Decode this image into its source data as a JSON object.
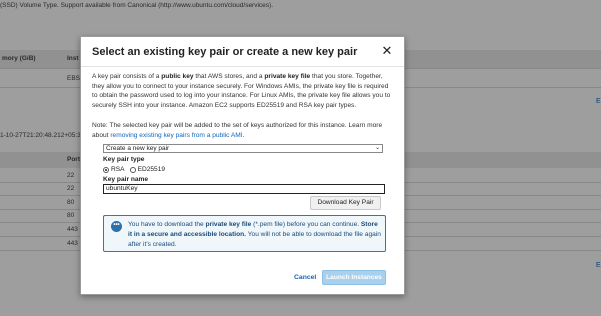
{
  "background": {
    "top_text": "(SSD) Volume Type. Support available from Canonical (http://www.ubuntu.com/cloud/services).",
    "col_memory": "mory (GiB)",
    "col_inst": "Inst",
    "ebs": "EBS",
    "timestamp": "1-10-27T21:20:48.212+05:3",
    "port_header": "Port",
    "ports": [
      "22",
      "22",
      "80",
      "80",
      "443",
      "443"
    ],
    "right_edge_1": "E",
    "right_edge_2": "E"
  },
  "modal": {
    "title": "Select an existing key pair or create a new key pair",
    "close_icon": "✕",
    "intro": {
      "p1": "A key pair consists of a ",
      "b1": "public key",
      "p2": " that AWS stores, and a ",
      "b2": "private key file",
      "p3": " that you store. Together, they allow you to connect to your instance securely. For Windows AMIs, the private key file is required to obtain the password used to log into your instance. For Linux AMIs, the private key file allows you to securely SSH into your instance. Amazon EC2 supports ED25519 and RSA key pair types."
    },
    "note": {
      "text": "Note: The selected key pair will be added to the set of keys authorized for this instance. Learn more about ",
      "link": "removing existing key pairs from a public AMI",
      "end": "."
    },
    "key_pair_select": {
      "value": "Create a new key pair",
      "caret": "⌄"
    },
    "key_pair_type_label": "Key pair type",
    "key_pair_type_options": [
      "RSA",
      "ED25519"
    ],
    "key_pair_type_selected": "RSA",
    "key_pair_name_label": "Key pair name",
    "key_pair_name_value": "ubuntuKey",
    "download_button": "Download Key Pair",
    "info": {
      "icon": "•••",
      "t1": "You have to download the ",
      "b1": "private key file",
      "t2": " (*.pem file) before you can continue. ",
      "b2": "Store it in a secure and accessible location.",
      "t3": " You will not be able to download the file again after it's created."
    },
    "cancel": "Cancel",
    "launch": "Launch Instances"
  }
}
